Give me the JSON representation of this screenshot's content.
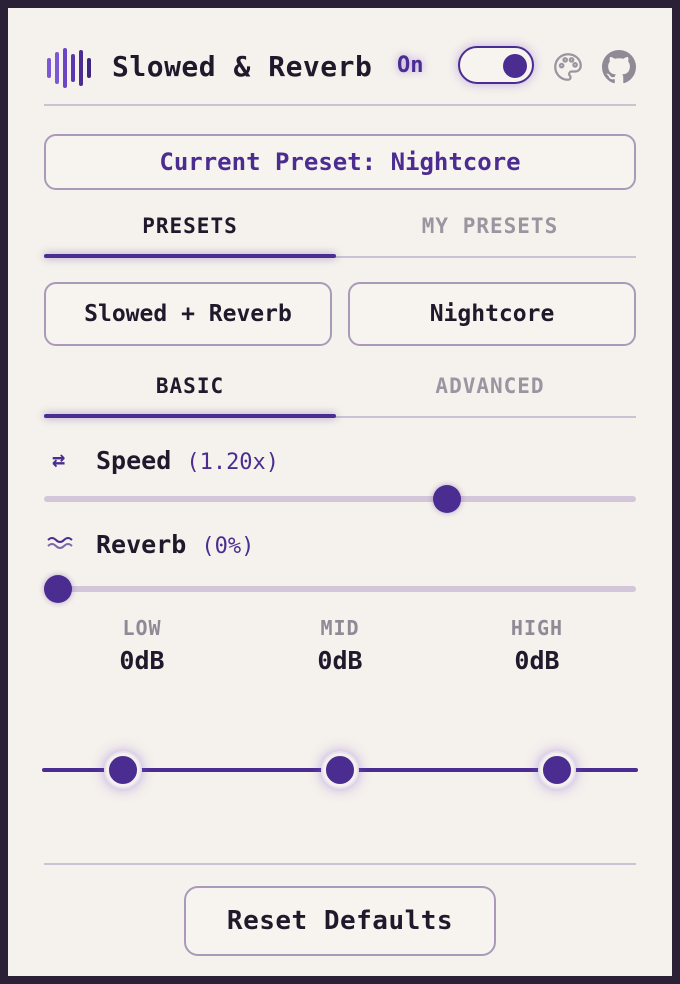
{
  "header": {
    "title": "Slowed & Reverb",
    "status": "On",
    "logo_icon": "waveform-icon",
    "theme_icon": "palette-icon",
    "repo_icon": "github-icon",
    "toggle_on": true
  },
  "current_preset": {
    "label": "Current Preset: Nightcore"
  },
  "preset_tabs": [
    {
      "label": "PRESETS",
      "active": true
    },
    {
      "label": "MY PRESETS",
      "active": false
    }
  ],
  "preset_buttons": [
    {
      "label": "Slowed + Reverb"
    },
    {
      "label": "Nightcore"
    }
  ],
  "mode_tabs": [
    {
      "label": "BASIC",
      "active": true
    },
    {
      "label": "ADVANCED",
      "active": false
    }
  ],
  "speed": {
    "icon": "swap-arrows-icon",
    "label": "Speed",
    "value_text": "(1.20x)",
    "slider_fraction": 0.69
  },
  "reverb": {
    "icon": "wave-icon",
    "label": "Reverb",
    "value_text": "(0%)",
    "slider_fraction": 0.0
  },
  "equalizer": {
    "bands": [
      {
        "name": "LOW",
        "value": "0dB"
      },
      {
        "name": "MID",
        "value": "0dB"
      },
      {
        "name": "HIGH",
        "value": "0dB"
      }
    ]
  },
  "footer": {
    "reset_label": "Reset Defaults"
  },
  "colors": {
    "accent": "#4b2d91",
    "background": "#f5f1ec",
    "frame": "#2b2137",
    "border": "#a99ab9"
  }
}
